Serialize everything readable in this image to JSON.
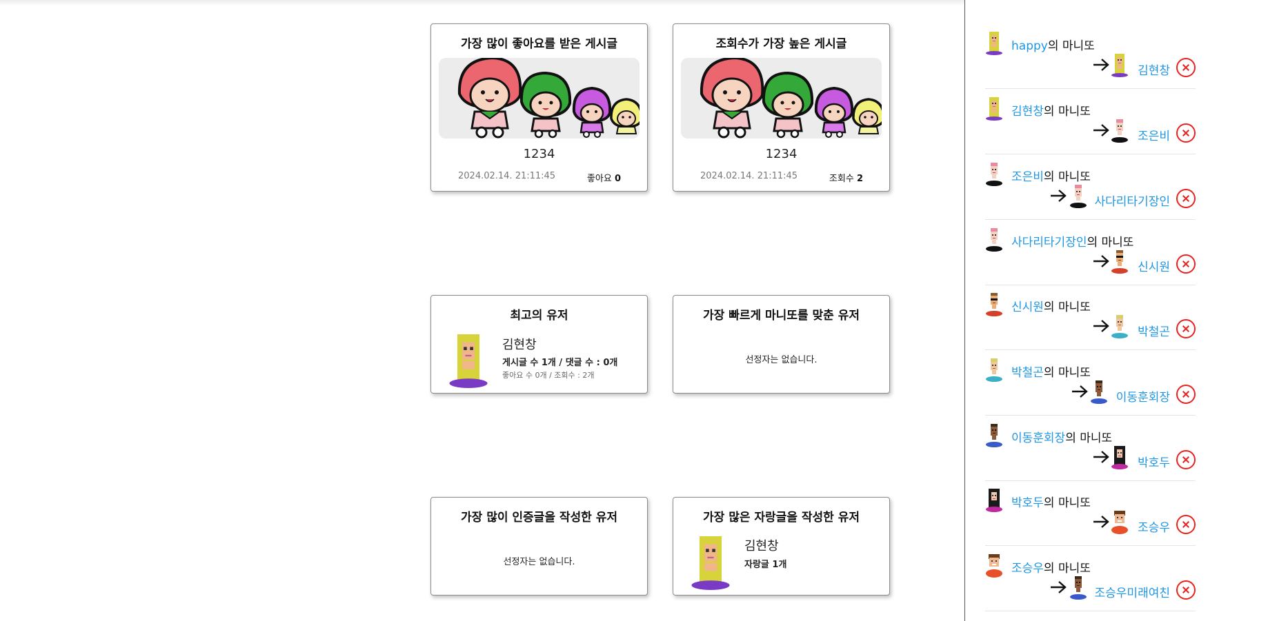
{
  "cards": {
    "most_liked": {
      "title": "가장 많이 좋아요를 받은 게시글",
      "post_name": "1234",
      "date": "2024.02.14. 21:11:45",
      "stat_label": "좋아요",
      "stat_value": "0"
    },
    "most_viewed": {
      "title": "조회수가 가장 높은 게시글",
      "post_name": "1234",
      "date": "2024.02.14. 21:11:45",
      "stat_label": "조회수",
      "stat_value": "2"
    },
    "best_user": {
      "title": "최고의 유저",
      "name": "김현창",
      "line1": "게시글 수 1개 / 댓글 수 : 0개",
      "line2": "좋아요 수 0개 / 조회수 : 2개"
    },
    "fastest_guess": {
      "title": "가장 빠르게 마니또를 맞춘 유저",
      "empty": "선정자는 없습니다."
    },
    "most_certification": {
      "title": "가장 많이 인증글을 작성한 유저",
      "empty": "선정자는 없습니다."
    },
    "most_boast": {
      "title": "가장 많은 자랑글을 작성한 유저",
      "name": "김현창",
      "line1": "자랑글 1개"
    }
  },
  "manitto": {
    "suffix": "의 마니또",
    "items": [
      {
        "giver": "happy",
        "receiver": "김현창"
      },
      {
        "giver": "김현창",
        "receiver": "조은비"
      },
      {
        "giver": "조은비",
        "receiver": "사다리타기장인"
      },
      {
        "giver": "사다리타기장인",
        "receiver": "신시원"
      },
      {
        "giver": "신시원",
        "receiver": "박철곤"
      },
      {
        "giver": "박철곤",
        "receiver": "이동훈회장"
      },
      {
        "giver": "이동훈회장",
        "receiver": "박호두"
      },
      {
        "giver": "박호두",
        "receiver": "조승우"
      },
      {
        "giver": "조승우",
        "receiver": "조승우미래여친"
      }
    ]
  },
  "icons": {
    "arrow": "arrow-right-icon",
    "delete": "close-circle-icon"
  },
  "colors": {
    "link": "#1e96e6",
    "delete": "#e8231f"
  }
}
